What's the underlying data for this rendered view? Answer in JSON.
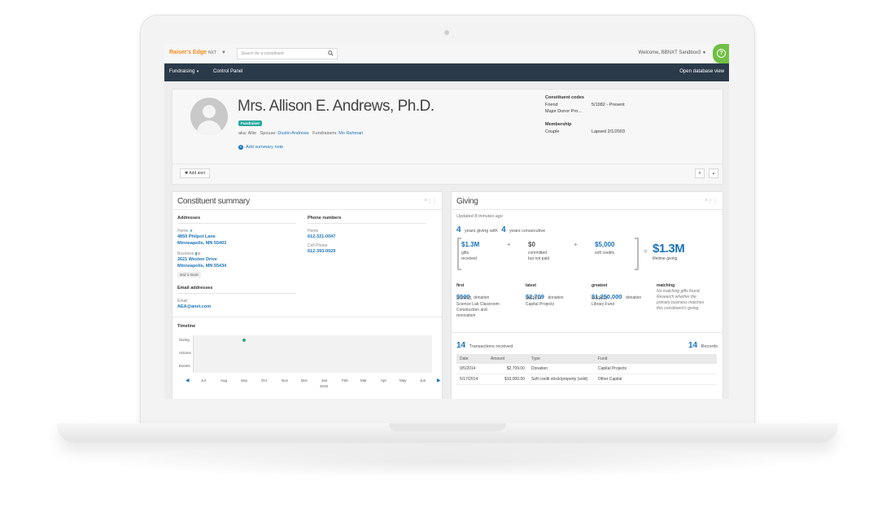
{
  "app": {
    "brand": "Raiser's Edge",
    "brand_suffix": "NXT",
    "search_placeholder": "Search for a constituent",
    "welcome": "Welcome, BBNXT Sandbox3",
    "help_icon": "?"
  },
  "nav": {
    "fundraising": "Fundraising",
    "control_panel": "Control Panel",
    "open_db": "Open database view"
  },
  "profile": {
    "name": "Mrs. Allison E. Andrews, Ph.D.",
    "badge": "Fundraiser",
    "aka_label": "aka:",
    "aka": "Allie",
    "spouse_label": "Spouse:",
    "spouse": "Dustin Andrews",
    "fundraisers_label": "Fundraisers:",
    "fundraisers": "Mo Rahman",
    "add_summary_note": "Add summary note",
    "add_alert": "Add alert",
    "codes_header": "Constituent codes",
    "codes": [
      {
        "name": "Friend",
        "value": "5/1982 - Present"
      },
      {
        "name": "Major Donor Pro...",
        "value": ""
      }
    ],
    "membership_header": "Membership",
    "membership": {
      "name": "Couple",
      "value": "Lapsed 2/1/2003"
    }
  },
  "summary": {
    "title": "Constituent summary",
    "addresses_header": "Addresses",
    "home_label": "Home",
    "home_line1": "4859 Philpot Lane",
    "home_line2": "Minneapolis, MN 55403",
    "business_label": "Business",
    "business_line1": "2621 Wexton Drive",
    "business_line2": "Minneapolis, MN 55434",
    "more": "and 1 more",
    "phones_header": "Phone numbers",
    "phone_home_label": "Home",
    "phone_home": "612-321-0047",
    "phone_cell_label": "Cell Phone",
    "phone_cell": "612-393-0029",
    "email_header": "Email addresses",
    "email_label": "Email",
    "email": "AEA@anet.com",
    "timeline_header": "Timeline",
    "timeline_rows": [
      "Giving",
      "Actions",
      "Events"
    ],
    "months": [
      "Jul",
      "Aug",
      "Sep",
      "Oct",
      "Nov",
      "Dec",
      "Jan",
      "Feb",
      "Mar",
      "Apr",
      "May",
      "Jun"
    ],
    "year": "2015"
  },
  "giving": {
    "title": "Giving",
    "updated": "Updated 8 minutes ago",
    "years_giving_num": "4",
    "years_giving_text": "years giving with",
    "years_consec_num": "4",
    "years_consec_text": "years consecutive",
    "gifts_amount": "$1.3M",
    "gifts_label1": "gifts",
    "gifts_label2": "received",
    "committed_amount": "$0",
    "committed_label1": "committed",
    "committed_label2": "but not paid",
    "soft_amount": "$5,000",
    "soft_label": "soft credits",
    "lifetime_amount": "$1.3M",
    "lifetime_label": "lifetime giving",
    "plus": "+",
    "equals": "=",
    "first_label": "first",
    "first_amount": "$500",
    "first_kind": "donation",
    "first_date": "2/1/2011",
    "first_fund1": "Science Lab Classroom",
    "first_fund2": "Construction and",
    "first_fund3": "renovation",
    "latest_label": "latest",
    "latest_amount": "$2,709",
    "latest_kind": "donation",
    "latest_date": "9/5/2014",
    "latest_fund": "Capital Projects",
    "greatest_label": "greatest",
    "greatest_amount": "$1,250,000",
    "greatest_kind": "donation",
    "greatest_date": "6/1/2013",
    "greatest_fund": "Library Fund",
    "matching_label": "matching",
    "matching_text1": "No matching gifts found.",
    "matching_text2": "Research whether the",
    "matching_text3": "primary business matches",
    "matching_text4": "this constituent's giving.",
    "tx_count": "14",
    "tx_label": "Transactions received",
    "records_count": "14",
    "records_label": "Records",
    "columns": [
      "Date",
      "Amount",
      "Type",
      "Fund"
    ],
    "rows": [
      {
        "date": "9/5/2014",
        "amount": "$2,709.00",
        "type": "Donation",
        "fund": "Capital Projects"
      },
      {
        "date": "5/17/2014",
        "amount": "$10,000.00",
        "type": "Soft credit stock/property (sold)",
        "fund": "Other Capital"
      }
    ]
  },
  "colors": {
    "brand": "#f28b1c",
    "nav": "#2b3a4a",
    "link": "#1a73b8",
    "badge": "#2aa8a0",
    "help": "#71c044"
  }
}
